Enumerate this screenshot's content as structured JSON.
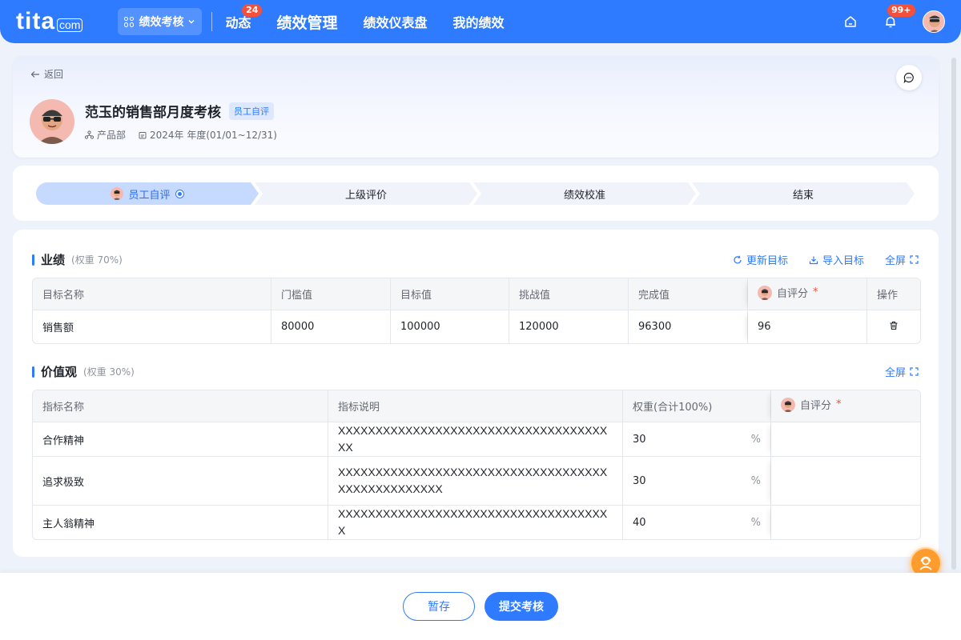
{
  "topbar": {
    "logo_main": "tita",
    "logo_sub": "com",
    "module": "绩效考核",
    "nav": [
      {
        "label": "动态",
        "badge": "24"
      },
      {
        "label": "绩效管理"
      },
      {
        "label": "绩效仪表盘"
      },
      {
        "label": "我的绩效"
      }
    ],
    "notification_badge": "99+"
  },
  "header": {
    "back": "返回",
    "title": "范玉的销售部月度考核",
    "tag": "员工自评",
    "department": "产品部",
    "period": "2024年 年度(01/01~12/31)"
  },
  "steps": [
    "员工自评",
    "上级评价",
    "绩效校准",
    "结束"
  ],
  "performance": {
    "title": "业绩",
    "weight": "(权重 70%)",
    "actions": {
      "refresh": "更新目标",
      "import": "导入目标",
      "fullscreen": "全屏"
    },
    "columns": [
      "目标名称",
      "门槛值",
      "目标值",
      "挑战值",
      "完成值",
      "自评分",
      "操作"
    ],
    "rows": [
      {
        "name": "销售额",
        "threshold": "80000",
        "target": "100000",
        "challenge": "120000",
        "actual": "96300",
        "score": "96"
      }
    ]
  },
  "values": {
    "title": "价值观",
    "weight": "(权重 30%)",
    "fullscreen": "全屏",
    "columns": [
      "指标名称",
      "指标说明",
      "权重(合计100%)",
      "自评分"
    ],
    "rows": [
      {
        "name": "合作精神",
        "desc": "XXXXXXXXXXXXXXXXXXXXXXXXXXXXXXXXXXXXXX",
        "weight": "30",
        "unit": "%"
      },
      {
        "name": "追求极致",
        "desc": "XXXXXXXXXXXXXXXXXXXXXXXXXXXXXXXXXXXXXXXXXXXXXXXXXX",
        "weight": "30",
        "unit": "%"
      },
      {
        "name": "主人翁精神",
        "desc": "XXXXXXXXXXXXXXXXXXXXXXXXXXXXXXXXXXXXX",
        "weight": "40",
        "unit": "%"
      }
    ]
  },
  "footer": {
    "save": "暂存",
    "submit": "提交考核"
  },
  "colors": {
    "primary": "#2f7bff",
    "danger": "#f5503b",
    "help": "#ff9c2e"
  }
}
